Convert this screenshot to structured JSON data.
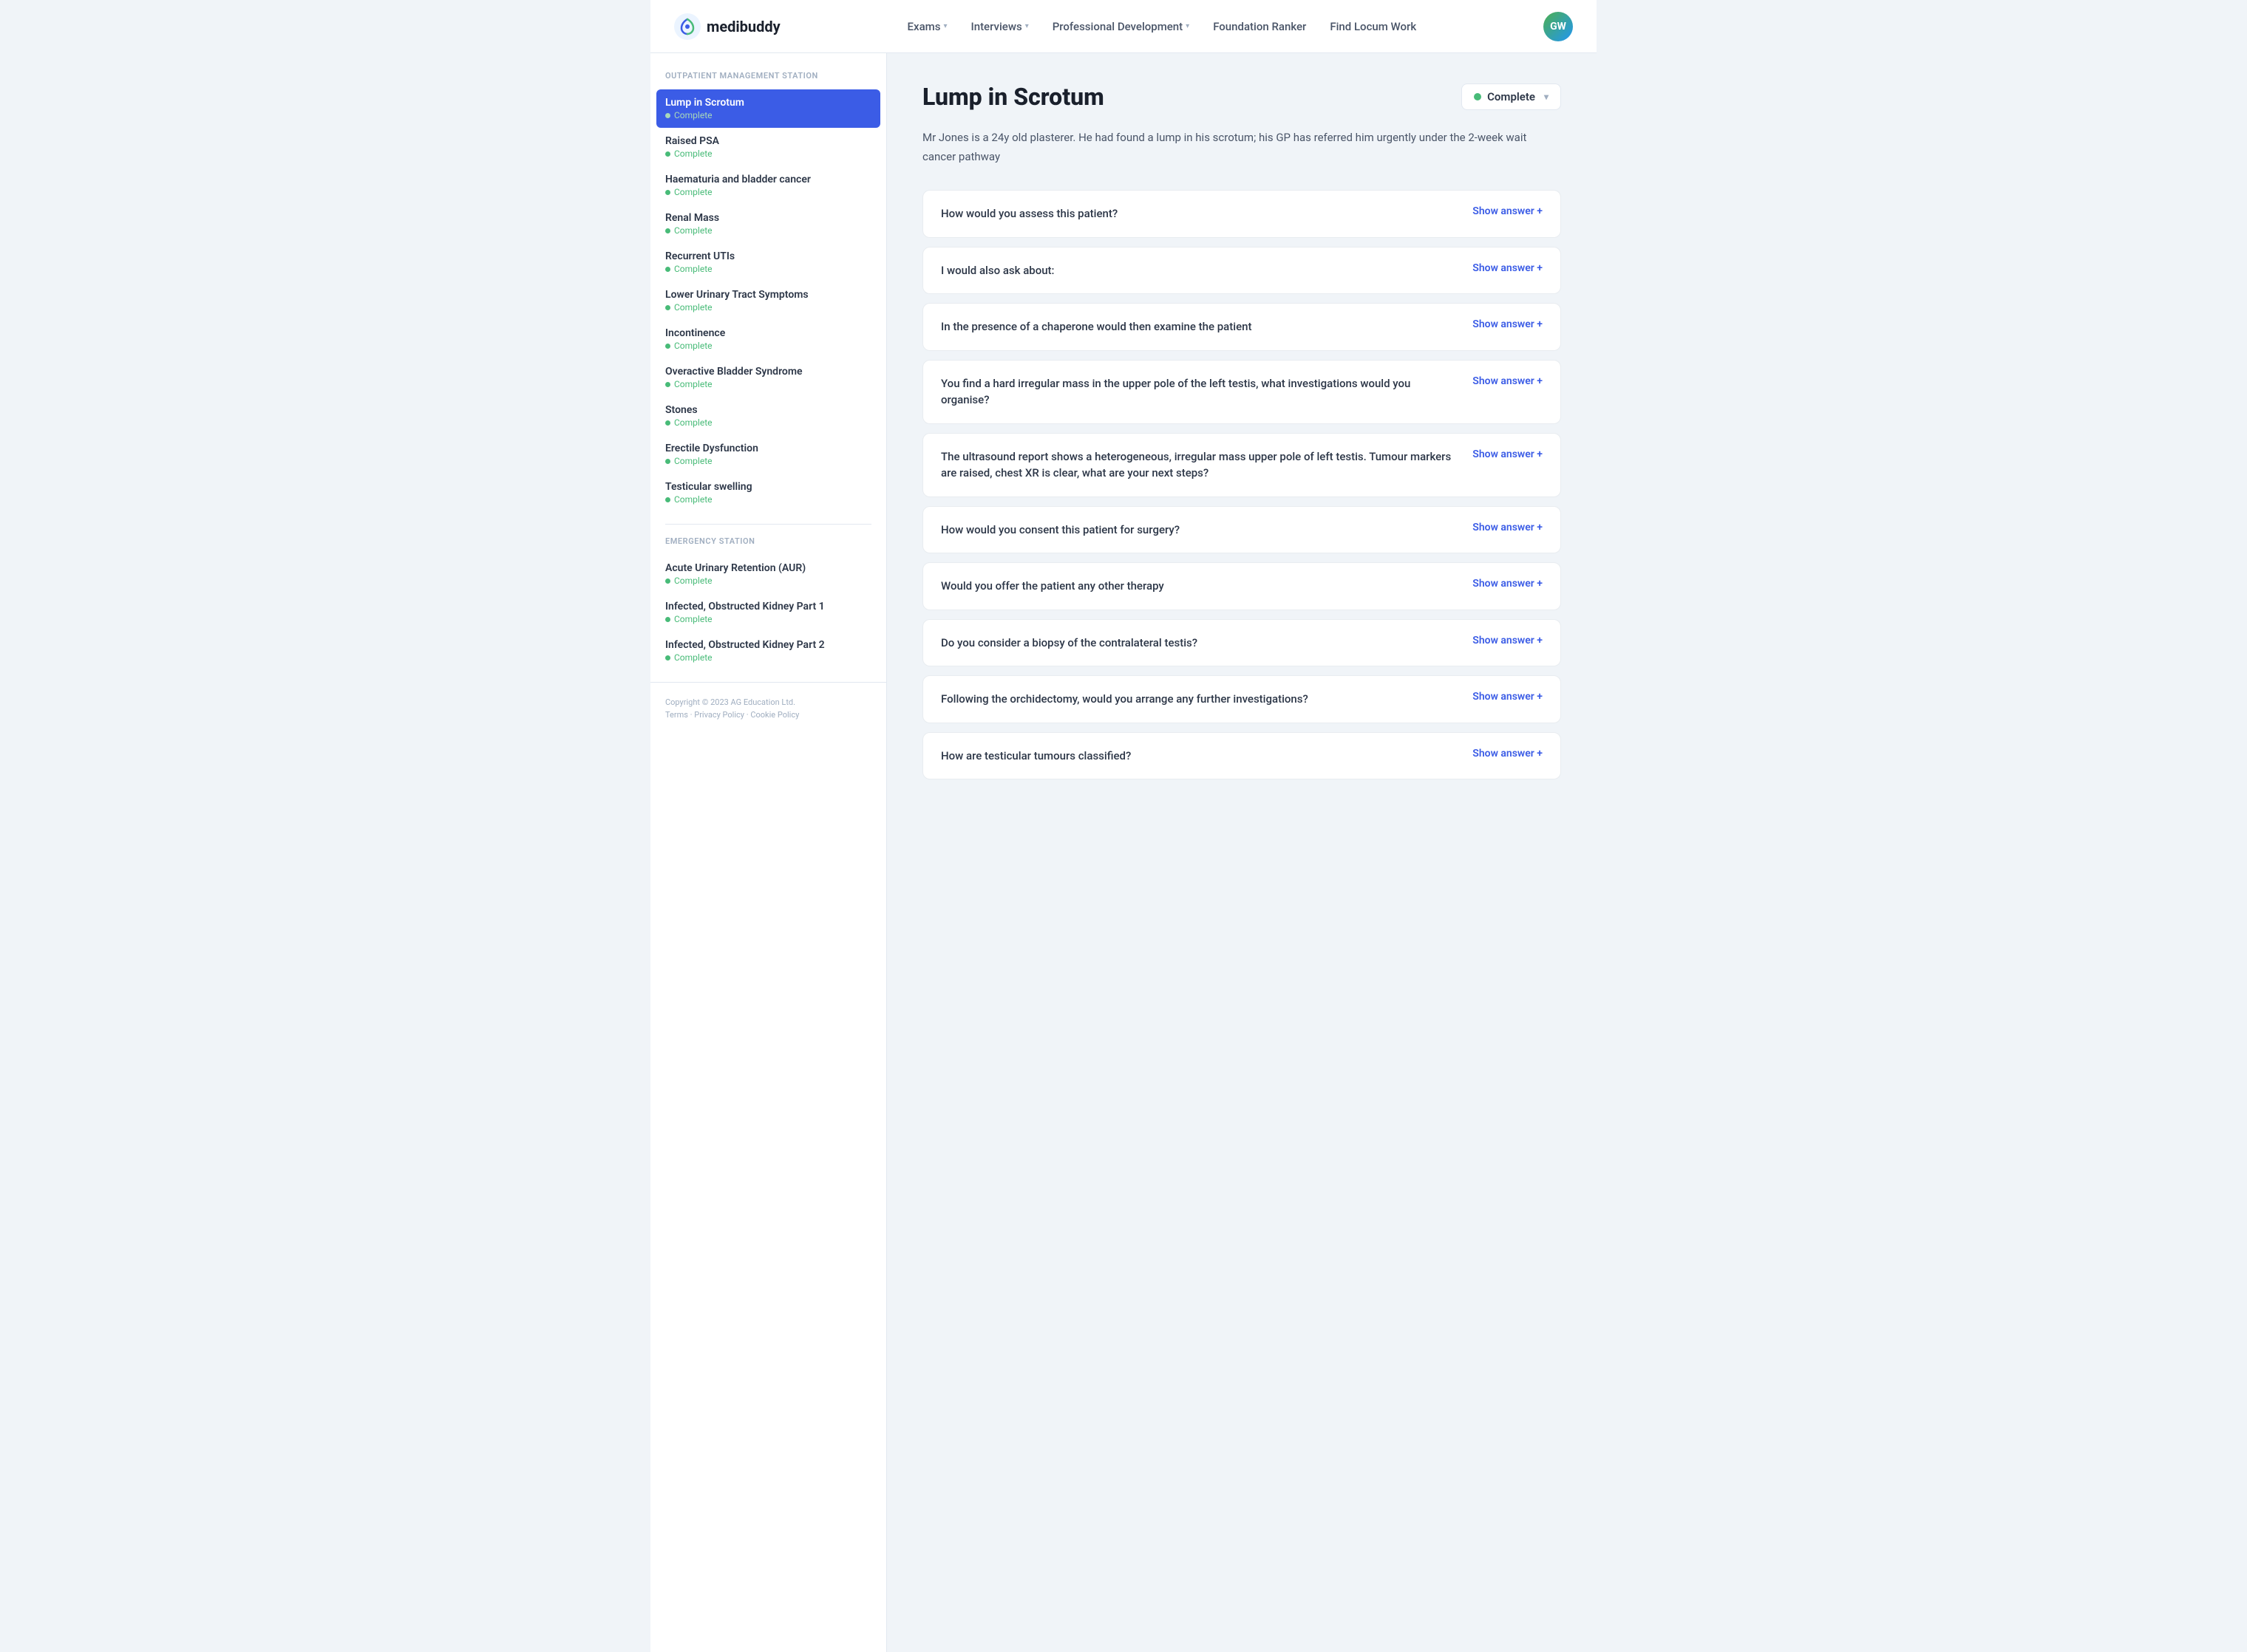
{
  "header": {
    "logo_text": "medibuddy",
    "nav": [
      {
        "label": "Exams",
        "has_dropdown": true
      },
      {
        "label": "Interviews",
        "has_dropdown": true
      },
      {
        "label": "Professional Development",
        "has_dropdown": true
      },
      {
        "label": "Foundation Ranker",
        "has_dropdown": false
      },
      {
        "label": "Find Locum Work",
        "has_dropdown": false
      }
    ],
    "avatar_initials": "GW"
  },
  "sidebar": {
    "section1_label": "Outpatient Management Station",
    "items_section1": [
      {
        "title": "Lump in Scrotum",
        "status": "Complete",
        "active": true
      },
      {
        "title": "Raised PSA",
        "status": "Complete",
        "active": false
      },
      {
        "title": "Haematuria and bladder cancer",
        "status": "Complete",
        "active": false
      },
      {
        "title": "Renal Mass",
        "status": "Complete",
        "active": false
      },
      {
        "title": "Recurrent UTIs",
        "status": "Complete",
        "active": false
      },
      {
        "title": "Lower Urinary Tract Symptoms",
        "status": "Complete",
        "active": false
      },
      {
        "title": "Incontinence",
        "status": "Complete",
        "active": false
      },
      {
        "title": "Overactive Bladder Syndrome",
        "status": "Complete",
        "active": false
      },
      {
        "title": "Stones",
        "status": "Complete",
        "active": false
      },
      {
        "title": "Erectile Dysfunction",
        "status": "Complete",
        "active": false
      },
      {
        "title": "Testicular swelling",
        "status": "Complete",
        "active": false
      }
    ],
    "section2_label": "Emergency Station",
    "items_section2": [
      {
        "title": "Acute Urinary Retention (AUR)",
        "status": "Complete",
        "active": false
      },
      {
        "title": "Infected, Obstructed Kidney Part 1",
        "status": "Complete",
        "active": false
      },
      {
        "title": "Infected, Obstructed Kidney Part 2",
        "status": "Complete",
        "active": false
      }
    ],
    "footer": {
      "copyright": "Copyright © 2023 AG Education Ltd.",
      "links": [
        "Terms",
        "Privacy Policy",
        "Cookie Policy"
      ]
    }
  },
  "content": {
    "page_title": "Lump in Scrotum",
    "status_label": "Complete",
    "intro": "Mr Jones is a 24y old plasterer. He had found a lump in his scrotum; his GP has referred him urgently under the 2-week wait cancer pathway",
    "questions": [
      {
        "text": "How would you assess this patient?",
        "show_answer_label": "Show answer +"
      },
      {
        "text": "I would also ask about:",
        "show_answer_label": "Show answer +"
      },
      {
        "text": "In the presence of a chaperone would then examine the patient",
        "show_answer_label": "Show answer +"
      },
      {
        "text": "You find a hard irregular mass in the upper pole of the left testis, what investigations would you organise?",
        "show_answer_label": "Show answer +"
      },
      {
        "text": "The ultrasound report shows a heterogeneous, irregular mass upper pole of left testis. Tumour markers are raised, chest XR is clear, what are your next steps?",
        "show_answer_label": "Show answer +"
      },
      {
        "text": "How would you consent this patient for surgery?",
        "show_answer_label": "Show answer +"
      },
      {
        "text": "Would you offer the patient any other therapy",
        "show_answer_label": "Show answer +"
      },
      {
        "text": "Do you consider a biopsy of the contralateral testis?",
        "show_answer_label": "Show answer +"
      },
      {
        "text": "Following the orchidectomy, would you arrange any further investigations?",
        "show_answer_label": "Show answer +"
      },
      {
        "text": "How are testicular tumours classified?",
        "show_answer_label": "Show answer +"
      }
    ]
  }
}
